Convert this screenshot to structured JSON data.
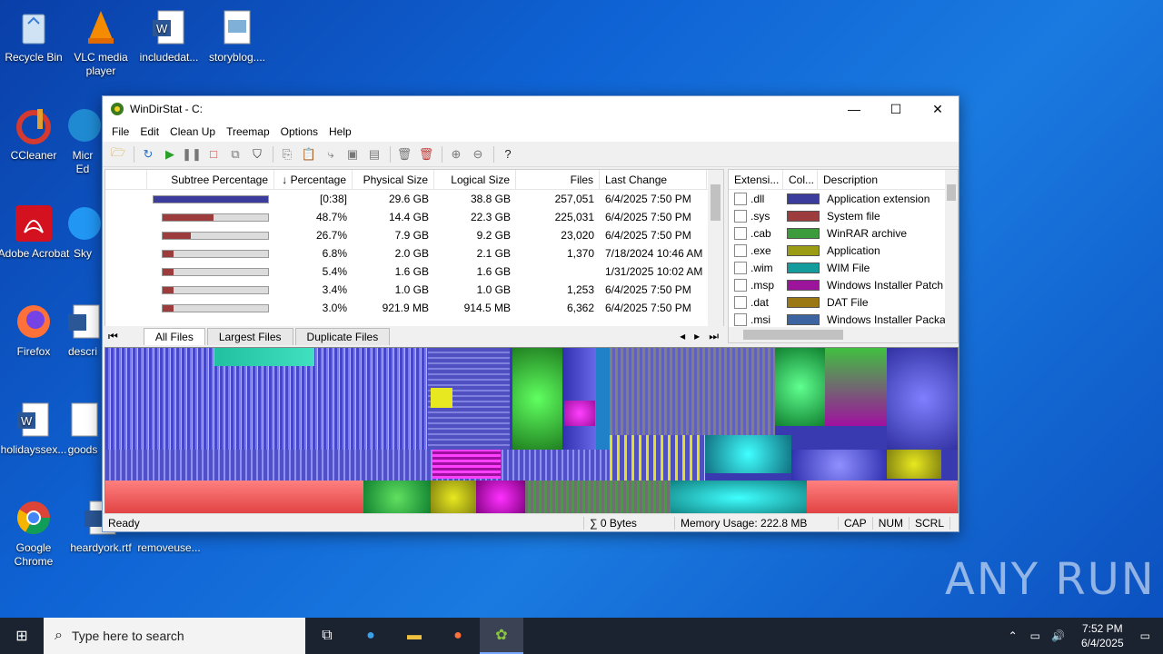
{
  "desktop": {
    "icons": [
      {
        "label": "Recycle Bin",
        "x": 0
      },
      {
        "label": "VLC media player"
      },
      {
        "label": "includedat..."
      },
      {
        "label": "storyblog...."
      },
      {
        "label": "CCleaner"
      },
      {
        "label": "Micr Ed"
      },
      {
        "label": "Adobe Acrobat"
      },
      {
        "label": "Sky"
      },
      {
        "label": "Firefox"
      },
      {
        "label": "descri"
      },
      {
        "label": "holidayssex..."
      },
      {
        "label": "goods"
      },
      {
        "label": "Google Chrome"
      },
      {
        "label": "heardyork.rtf"
      },
      {
        "label": "removeuse..."
      }
    ]
  },
  "window": {
    "title": "WinDirStat - C:",
    "menu": [
      "File",
      "Edit",
      "Clean Up",
      "Treemap",
      "Options",
      "Help"
    ]
  },
  "grid": {
    "headers": [
      "Subtree Percentage",
      "↓ Percentage",
      "Physical Size",
      "Logical Size",
      "Files",
      "Last Change"
    ],
    "rows": [
      {
        "pct": "[0:38]",
        "phys": "29.6 GB",
        "log": "38.8 GB",
        "files": "257,051",
        "change": "6/4/2025  7:50 PM",
        "fill": 1.0,
        "color": "#3c3c9c"
      },
      {
        "pct": "48.7%",
        "phys": "14.4 GB",
        "log": "22.3 GB",
        "files": "225,031",
        "change": "6/4/2025  7:50 PM",
        "fill": 0.487,
        "color": "#9c3c3c"
      },
      {
        "pct": "26.7%",
        "phys": "7.9 GB",
        "log": "9.2 GB",
        "files": "23,020",
        "change": "6/4/2025  7:50 PM",
        "fill": 0.267,
        "color": "#9c3c3c"
      },
      {
        "pct": "6.8%",
        "phys": "2.0 GB",
        "log": "2.1 GB",
        "files": "1,370",
        "change": "7/18/2024  10:46 AM",
        "fill": 0.068,
        "color": "#9c3c3c"
      },
      {
        "pct": "5.4%",
        "phys": "1.6 GB",
        "log": "1.6 GB",
        "files": "",
        "change": "1/31/2025  10:02 AM",
        "fill": 0.054,
        "color": "#9c3c3c"
      },
      {
        "pct": "3.4%",
        "phys": "1.0 GB",
        "log": "1.0 GB",
        "files": "1,253",
        "change": "6/4/2025  7:50 PM",
        "fill": 0.034,
        "color": "#9c3c3c"
      },
      {
        "pct": "3.0%",
        "phys": "921.9 MB",
        "log": "914.5 MB",
        "files": "6,362",
        "change": "6/4/2025  7:50 PM",
        "fill": 0.03,
        "color": "#9c3c3c"
      }
    ]
  },
  "tabs": [
    "All Files",
    "Largest Files",
    "Duplicate Files"
  ],
  "extensions": {
    "headers": [
      "Extensi...",
      "Col...",
      "Description"
    ],
    "rows": [
      {
        "ext": ".dll",
        "color": "#3c3c9c",
        "desc": "Application extension"
      },
      {
        "ext": ".sys",
        "color": "#9c3c3c",
        "desc": "System file"
      },
      {
        "ext": ".cab",
        "color": "#3c9c3c",
        "desc": "WinRAR archive"
      },
      {
        "ext": ".exe",
        "color": "#9c9c14",
        "desc": "Application"
      },
      {
        "ext": ".wim",
        "color": "#149c9c",
        "desc": "WIM File"
      },
      {
        "ext": ".msp",
        "color": "#9c149c",
        "desc": "Windows Installer Patch"
      },
      {
        "ext": ".dat",
        "color": "#9c7814",
        "desc": "DAT File"
      },
      {
        "ext": ".msi",
        "color": "#3c64a0",
        "desc": "Windows Installer Packag"
      }
    ]
  },
  "status": {
    "ready": "Ready",
    "sum": "∑ 0 Bytes",
    "memory": "Memory Usage: 222.8 MB",
    "cap": "CAP",
    "num": "NUM",
    "scrl": "SCRL"
  },
  "taskbar": {
    "search_placeholder": "Type here to search",
    "time": "7:52 PM",
    "date": "6/4/2025"
  },
  "watermark": "ANY RUN"
}
